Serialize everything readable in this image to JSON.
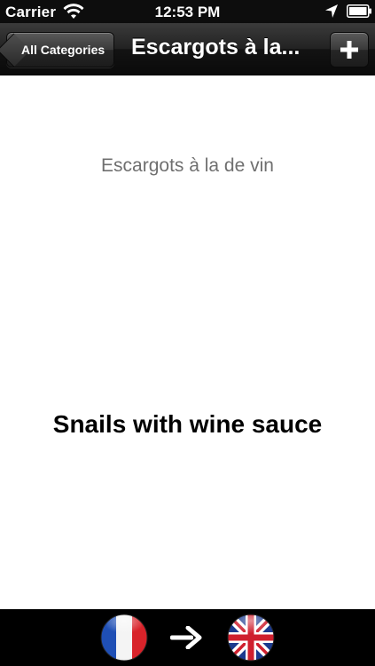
{
  "status_bar": {
    "carrier": "Carrier",
    "time": "12:53 PM",
    "icons": [
      "wifi-icon",
      "location-icon",
      "battery-icon"
    ]
  },
  "nav_bar": {
    "back_label": "All Categories",
    "title": "Escargots à la...",
    "add_icon": "plus-icon"
  },
  "content": {
    "original_phrase": "Escargots à la de vin",
    "translation": "Snails with wine sauce"
  },
  "language_switch": {
    "from_flag": "france-flag-icon",
    "arrow": "arrow-right-icon",
    "to_flag": "uk-flag-icon"
  },
  "colors": {
    "bar_background": "#000000",
    "original_text": "#6f6f6f",
    "translation_text": "#000000"
  }
}
